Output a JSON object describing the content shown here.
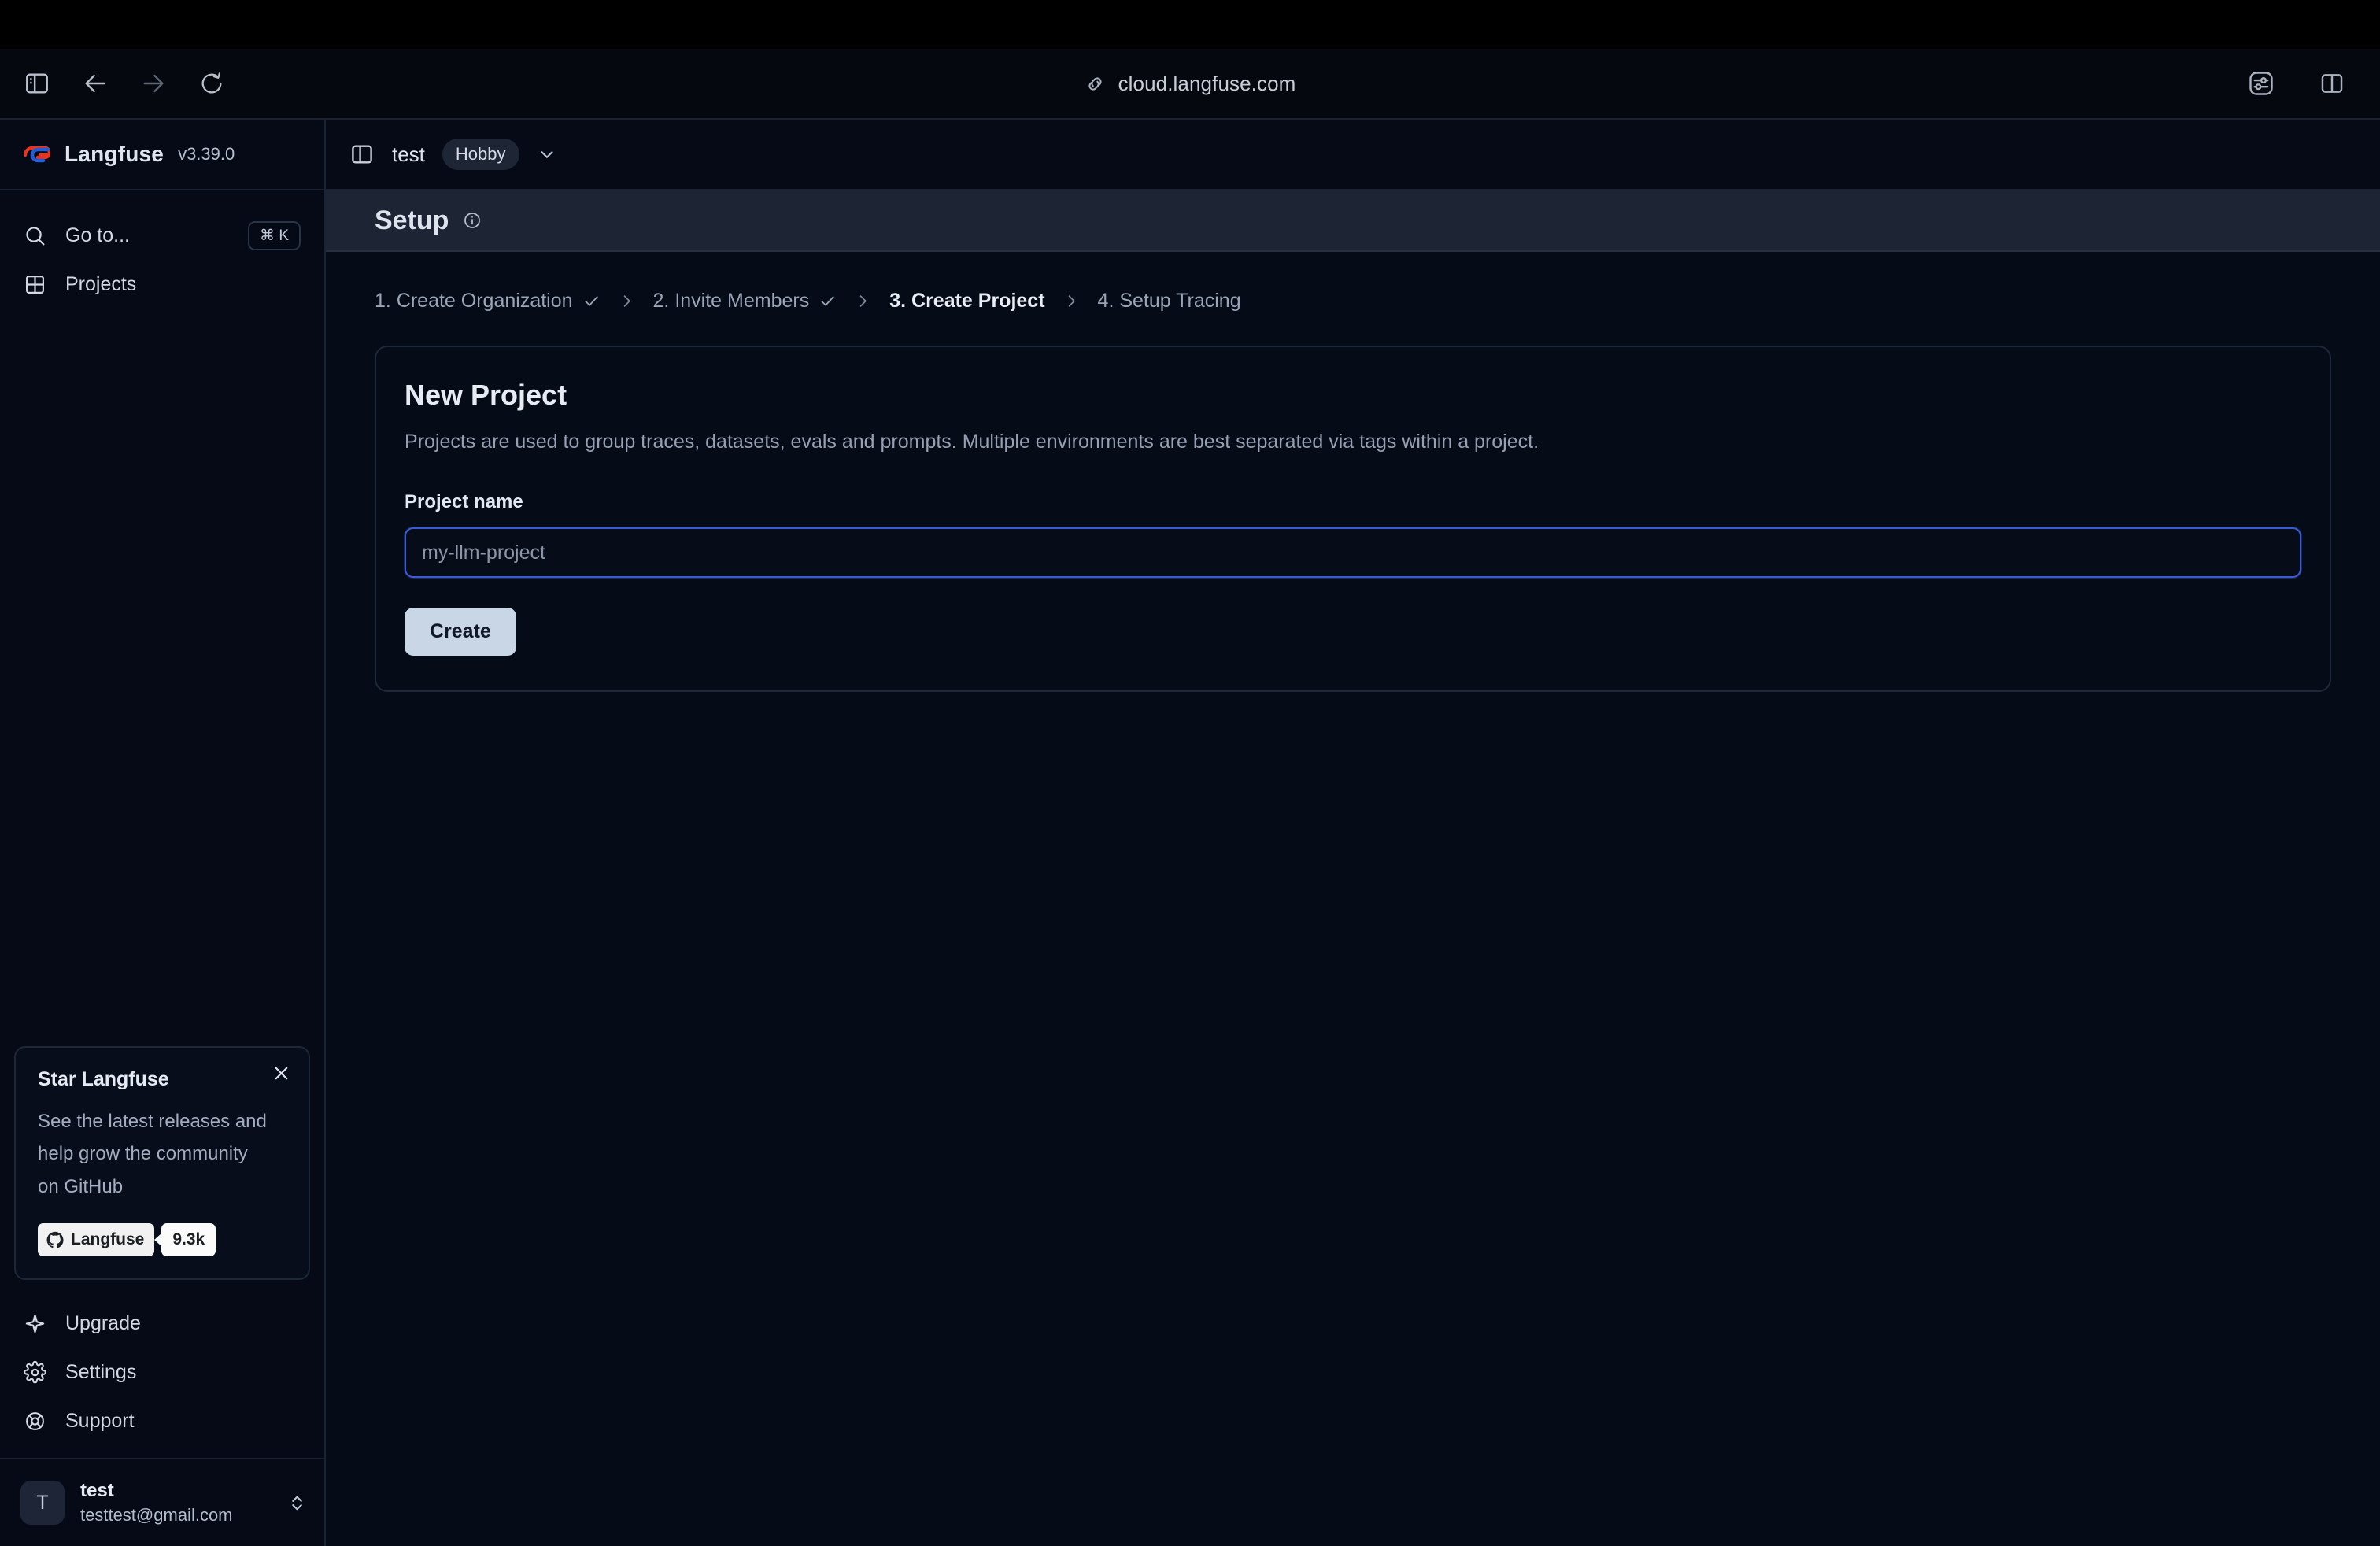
{
  "browser": {
    "url": "cloud.langfuse.com",
    "back_label": "Back",
    "forward_label": "Forward",
    "reload_label": "Reload",
    "sidebar_toggle_label": "Toggle Sidebar",
    "settings_label": "Page Settings",
    "split_view_label": "Split View"
  },
  "sidebar": {
    "brand": {
      "name": "Langfuse",
      "version": "v3.39.0"
    },
    "nav": [
      {
        "label": "Go to...",
        "icon": "search-icon",
        "shortcut": "⌘ K"
      },
      {
        "label": "Projects",
        "icon": "grid-icon"
      }
    ],
    "star_card": {
      "title": "Star Langfuse",
      "body": "See the latest releases and help grow the community on GitHub",
      "badge_label": "Langfuse",
      "badge_count": "9.3k",
      "close_label": "Dismiss"
    },
    "bottom_nav": [
      {
        "label": "Upgrade",
        "icon": "sparkle-icon"
      },
      {
        "label": "Settings",
        "icon": "gear-icon"
      },
      {
        "label": "Support",
        "icon": "life-buoy-icon"
      }
    ],
    "user": {
      "initial": "T",
      "name": "test",
      "email": "testtest@gmail.com"
    }
  },
  "header": {
    "project": "test",
    "plan_badge": "Hobby",
    "sidebar_toggle_label": "Toggle Navigation"
  },
  "page": {
    "title": "Setup",
    "info_label": "More information"
  },
  "stepper": {
    "steps": [
      {
        "label": "1. Create Organization",
        "state": "complete"
      },
      {
        "label": "2. Invite Members",
        "state": "complete"
      },
      {
        "label": "3. Create Project",
        "state": "active"
      },
      {
        "label": "4. Setup Tracing",
        "state": "pending"
      }
    ]
  },
  "card": {
    "title": "New Project",
    "description": "Projects are used to group traces, datasets, evals and prompts. Multiple environments are best separated via tags within a project.",
    "field_label": "Project name",
    "input_value": "",
    "input_placeholder": "my-llm-project",
    "submit_label": "Create"
  },
  "colors": {
    "app_background": "#060b18",
    "sidebar_background": "#050a16",
    "header_band": "#1d2433",
    "border": "#1b2333",
    "focus_blue": "#3b5bd4",
    "button_bg": "#c8d6e6",
    "text_primary": "#e6ebf3",
    "text_muted": "#96a0b2",
    "logo_red": "#e5341f",
    "logo_blue": "#1f5ed8"
  }
}
